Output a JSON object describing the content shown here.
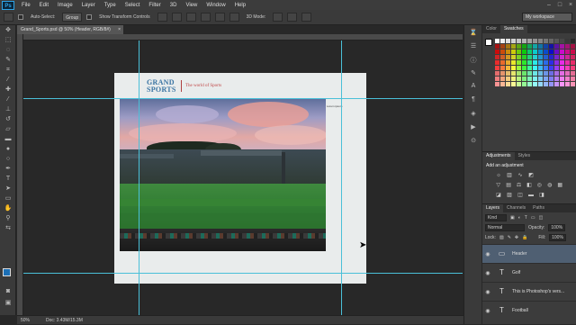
{
  "app": {
    "logo": "Ps"
  },
  "menu": [
    "File",
    "Edit",
    "Image",
    "Layer",
    "Type",
    "Select",
    "Filter",
    "3D",
    "View",
    "Window",
    "Help"
  ],
  "window_controls": [
    "–",
    "□",
    "×"
  ],
  "options": {
    "auto_select_label": "Auto-Select:",
    "auto_select_value": "Group",
    "transform_label": "Show Transform Controls",
    "mode_3d_label": "3D Mode:",
    "workspace": "My workspace"
  },
  "document": {
    "tab_title": "Grand_Sports.psd @ 50% (Header, RGB/8#)",
    "brand_line1": "GRAND",
    "brand_line2": "SPORTS",
    "tagline": "The world of Sports",
    "side_text": "Lorem ipsum"
  },
  "status": {
    "zoom": "50%",
    "doc": "Doc: 3.43M/15.3M"
  },
  "panels": {
    "color_tabs": [
      "Color",
      "Swatches"
    ],
    "adjust_tabs": [
      "Adjustments",
      "Styles"
    ],
    "adjust_title": "Add an adjustment",
    "layers_tabs": [
      "Layers",
      "Channels",
      "Paths"
    ],
    "kind": "Kind",
    "blend": "Normal",
    "opacity_label": "Opacity:",
    "opacity": "100%",
    "lock_label": "Lock:",
    "fill_label": "Fill:",
    "fill": "100%"
  },
  "layers": [
    {
      "name": "Header",
      "selected": true,
      "icon": "folder"
    },
    {
      "name": "Golf",
      "selected": false,
      "icon": "text"
    },
    {
      "name": "This is Photoshop's vers...",
      "selected": false,
      "icon": "text"
    },
    {
      "name": "Football",
      "selected": false,
      "icon": "text"
    }
  ],
  "colors": {
    "accent": "#2fa4e7",
    "guide": "#4ac0d8",
    "brand_blue": "#3a74a3",
    "brand_red": "#c04848"
  }
}
